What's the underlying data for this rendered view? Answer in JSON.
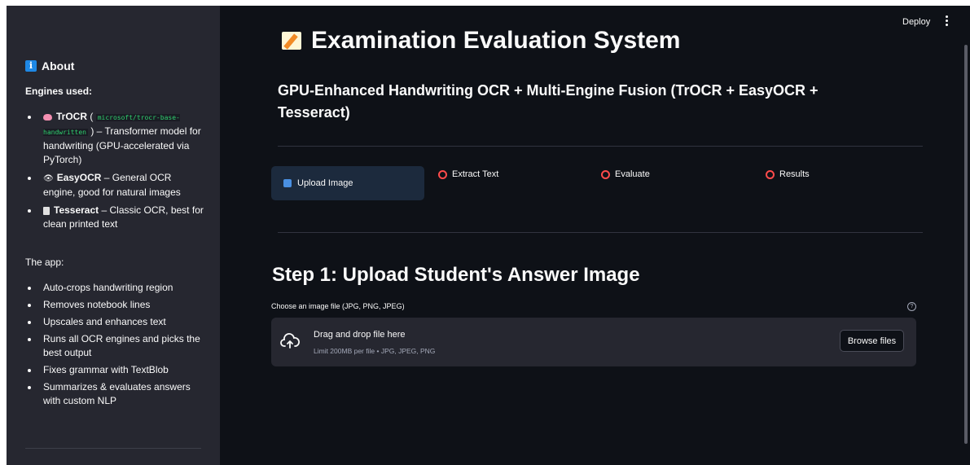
{
  "topbar": {
    "deploy_label": "Deploy"
  },
  "sidebar": {
    "heading": "About",
    "engines_title": "Engines used:",
    "engines": [
      {
        "name": "TrOCR",
        "pre": " ( ",
        "code": "microsoft/trocr-base-handwritten",
        "desc": " ) – Transformer model for handwriting (GPU-accelerated via PyTorch)"
      },
      {
        "name": "EasyOCR",
        "desc": " – General OCR engine, good for natural images"
      },
      {
        "name": "Tesseract",
        "desc": " – Classic OCR, best for clean printed text"
      }
    ],
    "app_title": "The app:",
    "app_items": [
      "Auto-crops handwriting region",
      "Removes notebook lines",
      "Upscales and enhances text",
      "Runs all OCR engines and picks the best output",
      "Fixes grammar with TextBlob",
      "Summarizes & evaluates answers with custom NLP"
    ]
  },
  "main": {
    "title": "Examination Evaluation System",
    "subtitle": "GPU-Enhanced Handwriting OCR + Multi-Engine Fusion (TrOCR + EasyOCR + Tesseract)",
    "steps": [
      {
        "label": "Upload Image",
        "active": true
      },
      {
        "label": "Extract Text",
        "active": false
      },
      {
        "label": "Evaluate",
        "active": false
      },
      {
        "label": "Results",
        "active": false
      }
    ],
    "step_heading": "Step 1: Upload Student's Answer Image",
    "uploader": {
      "label": "Choose an image file (JPG, PNG, JPEG)",
      "drag_text": "Drag and drop file here",
      "limit_text": "Limit 200MB per file • JPG, JPEG, PNG",
      "browse_label": "Browse files"
    }
  },
  "colors": {
    "accent": "#ff4b4b",
    "active_step_bg": "#1c2a3d",
    "sidebar_bg": "#262730",
    "main_bg": "#0e1117"
  }
}
